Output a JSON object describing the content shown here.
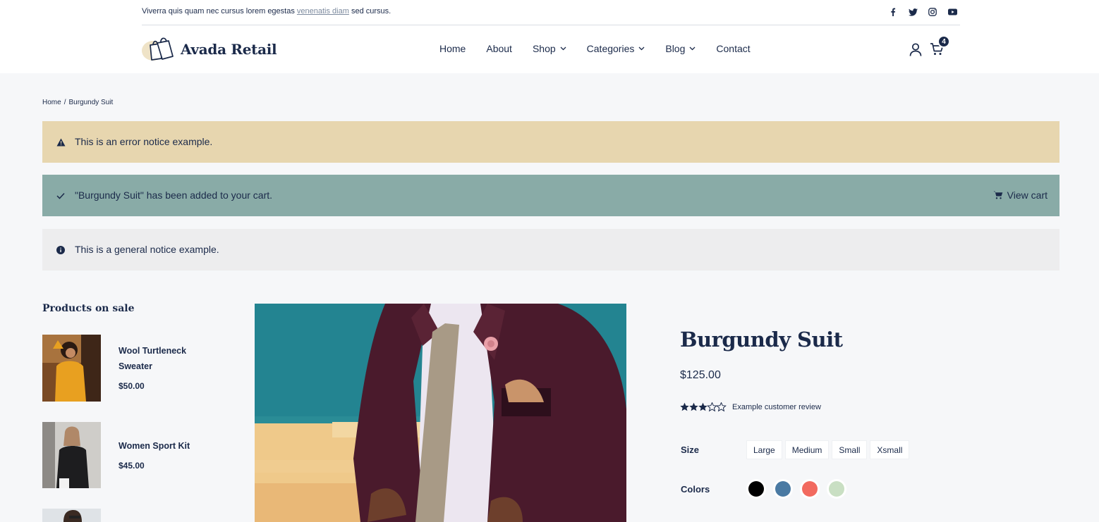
{
  "topbar": {
    "text_before": "Viverra quis quam nec cursus lorem egestas ",
    "link": "venenatis diam",
    "text_after": " sed cursus.",
    "social_icons": [
      "facebook-icon",
      "twitter-icon",
      "instagram-icon",
      "youtube-icon"
    ]
  },
  "brand": {
    "name": "Avada Retail"
  },
  "nav": {
    "items": [
      {
        "label": "Home",
        "dropdown": false
      },
      {
        "label": "About",
        "dropdown": false
      },
      {
        "label": "Shop",
        "dropdown": true
      },
      {
        "label": "Categories",
        "dropdown": true
      },
      {
        "label": "Blog",
        "dropdown": true
      },
      {
        "label": "Contact",
        "dropdown": false
      }
    ],
    "cart_count": "4"
  },
  "breadcrumb": {
    "home": "Home",
    "separator": "/",
    "current": "Burgundy Suit"
  },
  "notices": {
    "error": "This is an error notice example.",
    "success": "\"Burgundy Suit\" has been added to your cart.",
    "view_cart": "View cart",
    "info": "This is a general notice example."
  },
  "sidebar": {
    "title": "Products on sale",
    "items": [
      {
        "name": "Wool Turtleneck Sweater",
        "price": "$50.00"
      },
      {
        "name": "Women Sport Kit",
        "price": "$45.00"
      }
    ]
  },
  "product": {
    "title": "Burgundy Suit",
    "price": "$125.00",
    "rating": 3.5,
    "rating_max": 5,
    "review_link": "Example customer review",
    "size_label": "Size",
    "sizes": [
      "Large",
      "Medium",
      "Small",
      "Xsmall"
    ],
    "colors_label": "Colors",
    "colors": [
      "#000000",
      "#4a7aa3",
      "#f26a5f",
      "#c9dfc3"
    ]
  },
  "theme": {
    "navy": "#1b2a4a",
    "error_bg": "#e7d6af",
    "success_bg": "#89aba7",
    "info_bg": "#ededee"
  }
}
